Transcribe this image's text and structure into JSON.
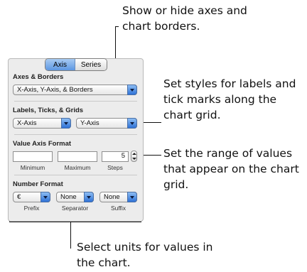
{
  "callouts": {
    "top": [
      "Show or hide axes and",
      "chart borders."
    ],
    "labels": [
      "Set styles for labels and",
      "tick marks along the",
      "chart grid."
    ],
    "range": [
      "Set the range of values",
      "that appear on the chart",
      "grid."
    ],
    "units": [
      "Select units for values in",
      "the chart."
    ]
  },
  "tabs": {
    "axis": "Axis",
    "series": "Series"
  },
  "axes_borders": {
    "heading": "Axes & Borders",
    "value": "X-Axis, Y-Axis, & Borders"
  },
  "labels_ticks": {
    "heading": "Labels, Ticks, & Grids",
    "x_value": "X-Axis",
    "y_value": "Y-Axis"
  },
  "value_axis": {
    "heading": "Value Axis Format",
    "minimum_value": "",
    "maximum_value": "",
    "steps_value": "5",
    "minimum_label": "Minimum",
    "maximum_label": "Maximum",
    "steps_label": "Steps"
  },
  "number_format": {
    "heading": "Number Format",
    "prefix_value": "€",
    "separator_value": "None",
    "suffix_value": "None",
    "prefix_label": "Prefix",
    "separator_label": "Separator",
    "suffix_label": "Suffix"
  }
}
